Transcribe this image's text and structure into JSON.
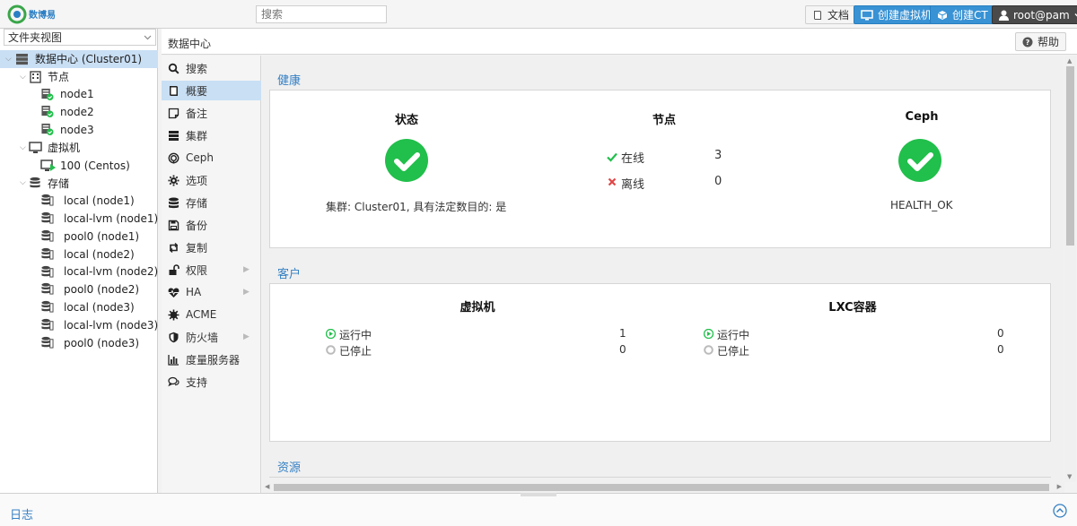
{
  "topbar": {
    "logo_text": "数博易",
    "search_placeholder": "搜索",
    "docs_label": "文档",
    "create_vm_label": "创建虚拟机",
    "create_ct_label": "创建CT",
    "user_label": "root@pam"
  },
  "tree": {
    "view_selector": "文件夹视图",
    "items": [
      {
        "label": "数据中心 (Cluster01)"
      },
      {
        "label": "节点"
      },
      {
        "label": "node1"
      },
      {
        "label": "node2"
      },
      {
        "label": "node3"
      },
      {
        "label": "虚拟机"
      },
      {
        "label": "100 (Centos)"
      },
      {
        "label": "存储"
      },
      {
        "label": "local (node1)"
      },
      {
        "label": "local-lvm (node1)"
      },
      {
        "label": "pool0 (node1)"
      },
      {
        "label": "local (node2)"
      },
      {
        "label": "local-lvm (node2)"
      },
      {
        "label": "pool0 (node2)"
      },
      {
        "label": "local (node3)"
      },
      {
        "label": "local-lvm (node3)"
      },
      {
        "label": "pool0 (node3)"
      }
    ]
  },
  "content_header": {
    "title": "数据中心",
    "help_label": "帮助"
  },
  "menu": {
    "items": [
      {
        "label": "搜索"
      },
      {
        "label": "概要"
      },
      {
        "label": "备注"
      },
      {
        "label": "集群"
      },
      {
        "label": "Ceph"
      },
      {
        "label": "选项"
      },
      {
        "label": "存储"
      },
      {
        "label": "备份"
      },
      {
        "label": "复制"
      },
      {
        "label": "权限"
      },
      {
        "label": "HA"
      },
      {
        "label": "ACME"
      },
      {
        "label": "防火墙"
      },
      {
        "label": "度量服务器"
      },
      {
        "label": "支持"
      }
    ]
  },
  "health": {
    "section_title": "健康",
    "status_title": "状态",
    "status_text": "集群: Cluster01, 具有法定数目的: 是",
    "nodes_title": "节点",
    "online_label": "在线",
    "online_count": "3",
    "offline_label": "离线",
    "offline_count": "0",
    "ceph_title": "Ceph",
    "ceph_status": "HEALTH_OK"
  },
  "guests": {
    "section_title": "客户",
    "vm_title": "虚拟机",
    "vm_running_label": "运行中",
    "vm_running": "1",
    "vm_stopped_label": "已停止",
    "vm_stopped": "0",
    "lxc_title": "LXC容器",
    "lxc_running_label": "运行中",
    "lxc_running": "0",
    "lxc_stopped_label": "已停止",
    "lxc_stopped": "0"
  },
  "resources": {
    "section_title": "资源"
  },
  "footer": {
    "log_label": "日志"
  },
  "colors": {
    "accent": "#3892d4",
    "success": "#21bf4b",
    "selection": "#c9dff4"
  }
}
